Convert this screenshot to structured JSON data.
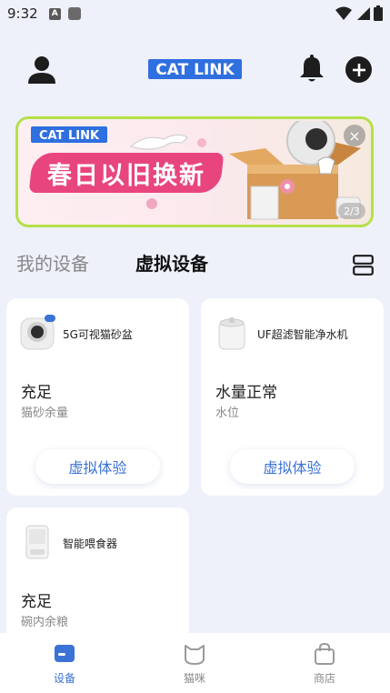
{
  "status_bar": {
    "time": "9:32",
    "notification_a": "A"
  },
  "app_bar": {
    "logo_text": "CAT LINK",
    "icons": [
      "user-icon",
      "bell-icon",
      "add-icon"
    ]
  },
  "banner": {
    "logo_text": "CAT LINK",
    "title": "春日以旧换新",
    "pager": "2/3",
    "close": "×"
  },
  "tabs": {
    "mine": "我的设备",
    "virtual": "虚拟设备",
    "active": "virtual"
  },
  "devices": [
    {
      "name": "5G可视猫砂盆",
      "status": "充足",
      "status_label": "猫砂余量",
      "button": "虚拟体验"
    },
    {
      "name": "UF超滤智能净水机",
      "status": "水量正常",
      "status_label": "水位",
      "button": "虚拟体验"
    },
    {
      "name": "智能喂食器",
      "status": "充足",
      "status_label": "碗内余粮"
    }
  ],
  "bottom_nav": {
    "items": [
      {
        "label": "设备",
        "icon": "device-icon",
        "active": true
      },
      {
        "label": "猫咪",
        "icon": "cat-icon",
        "active": false
      },
      {
        "label": "商店",
        "icon": "shop-bag-icon",
        "active": false
      }
    ]
  },
  "colors": {
    "accent": "#3b72d6",
    "brand_logo": "#2f6fe0",
    "banner_border": "#b5e04a",
    "banner_ribbon": "#e8457f",
    "background": "#eef1fa"
  }
}
